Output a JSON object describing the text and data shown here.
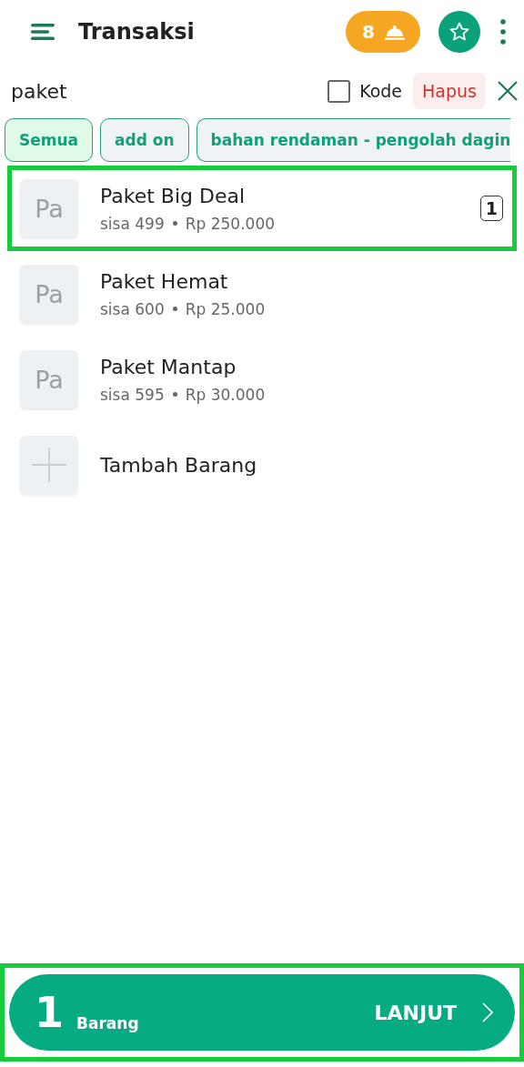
{
  "app_bar": {
    "title": "Transaksi",
    "order_badge": "8"
  },
  "search": {
    "value": "paket",
    "code_filter": {
      "label": "Kode",
      "checked": false
    },
    "clear_label": "Hapus"
  },
  "categories": [
    {
      "label": "Semua",
      "selected": true
    },
    {
      "label": "add on",
      "selected": false
    },
    {
      "label": "bahan rendaman - pengolah dagin",
      "selected": false
    }
  ],
  "items": [
    {
      "kind": "product",
      "thumb": "Pa",
      "name": "Paket Big Deal",
      "stock": "sisa 499",
      "price": "Rp 250.000",
      "quantity": "1",
      "highlighted": true
    },
    {
      "kind": "product",
      "thumb": "Pa",
      "name": "Paket Hemat",
      "stock": "sisa 600",
      "price": "Rp 25.000",
      "highlighted": false
    },
    {
      "kind": "product",
      "thumb": "Pa",
      "name": "Paket Mantap",
      "stock": "sisa 595",
      "price": "Rp 30.000",
      "highlighted": false
    },
    {
      "kind": "add",
      "name": "Tambah Barang",
      "highlighted": false
    }
  ],
  "checkout": {
    "count": "1",
    "unit": "Barang",
    "action": "LANJUT",
    "highlighted": true
  }
}
